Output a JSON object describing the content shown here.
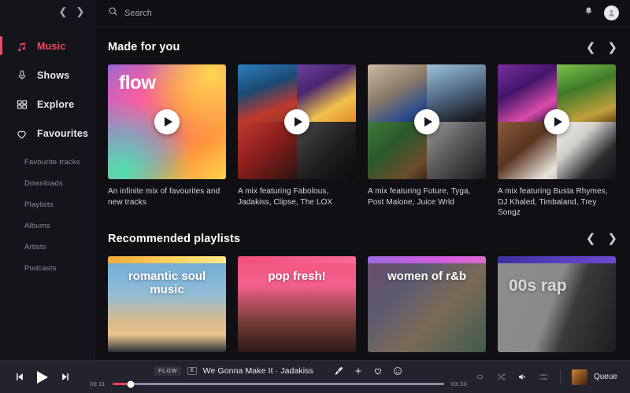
{
  "sidebar": {
    "nav": {
      "back_icon": "chevron-left-icon",
      "forward_icon": "chevron-right-icon"
    },
    "items": [
      {
        "label": "Music",
        "icon": "music-note-icon",
        "active": true
      },
      {
        "label": "Shows",
        "icon": "microphone-icon",
        "active": false
      },
      {
        "label": "Explore",
        "icon": "grid-icon",
        "active": false
      },
      {
        "label": "Favourites",
        "icon": "heart-icon",
        "active": false
      }
    ],
    "sub_items": [
      {
        "label": "Favourite tracks"
      },
      {
        "label": "Downloads"
      },
      {
        "label": "Playlists"
      },
      {
        "label": "Albums"
      },
      {
        "label": "Artists"
      },
      {
        "label": "Podcasts"
      }
    ]
  },
  "topbar": {
    "search": {
      "placeholder": "Search",
      "value": "",
      "icon": "search-icon"
    },
    "notifications_icon": "bell-icon",
    "avatar_icon": "user-avatar"
  },
  "sections": [
    {
      "title": "Made for you",
      "prev_icon": "chevron-left-icon",
      "next_icon": "chevron-right-icon",
      "cards": [
        {
          "overlay_title": "flow",
          "caption": "An infinite mix of favourites and new tracks",
          "play_icon": "play-icon"
        },
        {
          "overlay_title": "",
          "caption": "A mix featuring Fabolous, Jadakiss, Clipse, The LOX",
          "play_icon": "play-icon"
        },
        {
          "overlay_title": "",
          "caption": "A mix featuring Future, Tyga, Post Malone, Juice Wrld",
          "play_icon": "play-icon"
        },
        {
          "overlay_title": "",
          "caption": "A mix featuring Busta Rhymes, DJ Khaled, Timbaland, Trey Songz",
          "play_icon": "play-icon"
        }
      ]
    },
    {
      "title": "Recommended playlists",
      "prev_icon": "chevron-left-icon",
      "next_icon": "chevron-right-icon",
      "cards": [
        {
          "title": "romantic soul music"
        },
        {
          "title": "pop fresh!"
        },
        {
          "title": "women of r&b"
        },
        {
          "title": "00s rap"
        }
      ]
    }
  ],
  "player": {
    "prev_icon": "previous-track-icon",
    "play_icon": "play-icon",
    "next_icon": "next-track-icon",
    "source_badge": "FLOW",
    "explicit_badge": "E",
    "track": "We Gonna Make It · Jadakiss",
    "elapsed": "00:11",
    "duration": "03:33",
    "actions": [
      {
        "icon": "microphone-lyrics-icon"
      },
      {
        "icon": "plus-add-icon"
      },
      {
        "icon": "heart-icon"
      },
      {
        "icon": "smiley-reaction-icon"
      }
    ],
    "right_icons": [
      {
        "icon": "repeat-icon",
        "active": false
      },
      {
        "icon": "shuffle-icon",
        "active": false
      },
      {
        "icon": "volume-icon",
        "active": true
      },
      {
        "icon": "equalizer-icon",
        "active": false
      }
    ],
    "queue_label": "Queue"
  },
  "colors": {
    "accent": "#ef4a60",
    "progress": "#e94057",
    "app_bg": "#0f0f14",
    "sidebar_bg": "#14141b",
    "player_bg": "#23232e"
  }
}
